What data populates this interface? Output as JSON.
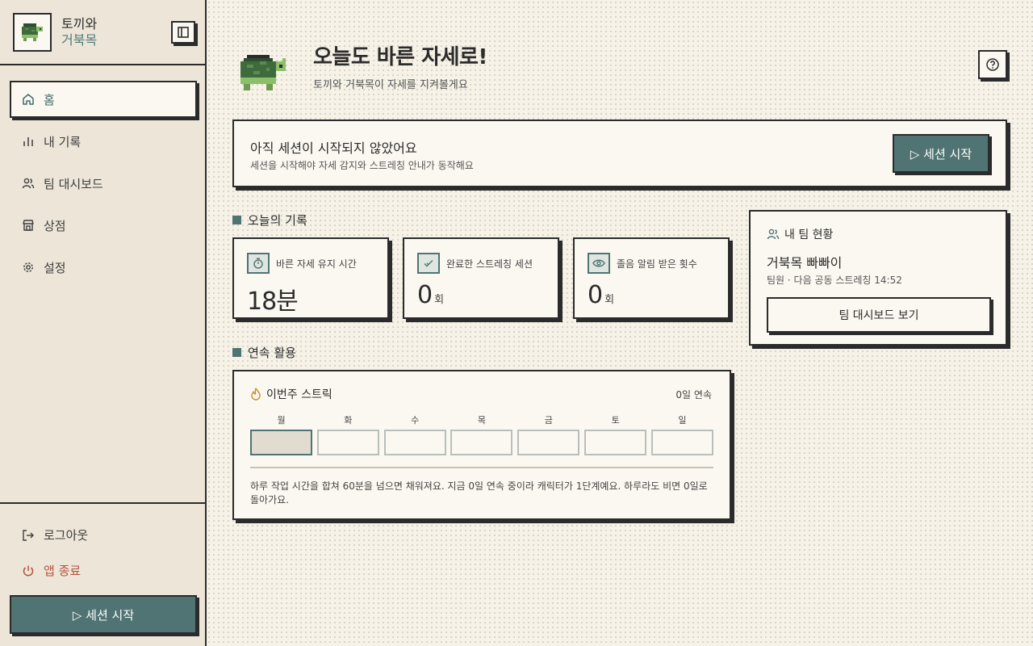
{
  "brand": {
    "line1": "토끼와",
    "line2": "거북목"
  },
  "nav": {
    "items": [
      {
        "label": "홈",
        "icon": "home-icon",
        "active": true
      },
      {
        "label": "내 기록",
        "icon": "bar-chart-icon",
        "active": false
      },
      {
        "label": "팀 대시보드",
        "icon": "users-icon",
        "active": false
      },
      {
        "label": "상점",
        "icon": "store-icon",
        "active": false
      },
      {
        "label": "설정",
        "icon": "gear-icon",
        "active": false
      }
    ]
  },
  "sidebar_bottom": {
    "logout_label": "로그아웃",
    "quit_label": "앱 종료",
    "start_label": "▷ 세션 시작"
  },
  "hero": {
    "title": "오늘도 바른 자세로!",
    "subtitle": "토끼와 거북목이 자세를 지켜볼게요"
  },
  "session": {
    "title": "아직 세션이 시작되지 않았어요",
    "description": "세션을 시작해야 자세 감지와 스트레칭 안내가 동작해요",
    "button_label": "▷ 세션 시작"
  },
  "today": {
    "section_title": "오늘의 기록",
    "stats": [
      {
        "label": "바른 자세 유지 시간",
        "value": "18분",
        "unit": "",
        "icon": "timer-icon"
      },
      {
        "label": "완료한 스트레칭 세션",
        "value": "0",
        "unit": "회",
        "icon": "check-icon"
      },
      {
        "label": "졸음 알림 받은 횟수",
        "value": "0",
        "unit": "회",
        "icon": "eye-icon"
      }
    ]
  },
  "team": {
    "title": "내 팀 현황",
    "name": "거북목 빠빠이",
    "meta": "팀원 · 다음 공동 스트레칭 14:52",
    "button_label": "팀 대시보드 보기"
  },
  "streak": {
    "section_title": "연속 활용",
    "title": "이번주 스트릭",
    "count_text": "0일 연속",
    "days": [
      {
        "label": "월",
        "today": true
      },
      {
        "label": "화",
        "today": false
      },
      {
        "label": "수",
        "today": false
      },
      {
        "label": "목",
        "today": false
      },
      {
        "label": "금",
        "today": false
      },
      {
        "label": "토",
        "today": false
      },
      {
        "label": "일",
        "today": false
      }
    ],
    "note": "하루 작업 시간을 합쳐 60분을 넘으면 채워져요. 지금 0일 연속 중이라 캐릭터가 1단계예요. 하루라도 비면 0일로 돌아가요."
  },
  "colors": {
    "accent": "#4f7473",
    "background": "#f6f2e8",
    "sidebar": "#ede6d8",
    "card": "#fbf8f1",
    "border": "#2b2b2b",
    "danger": "#b4533d"
  }
}
